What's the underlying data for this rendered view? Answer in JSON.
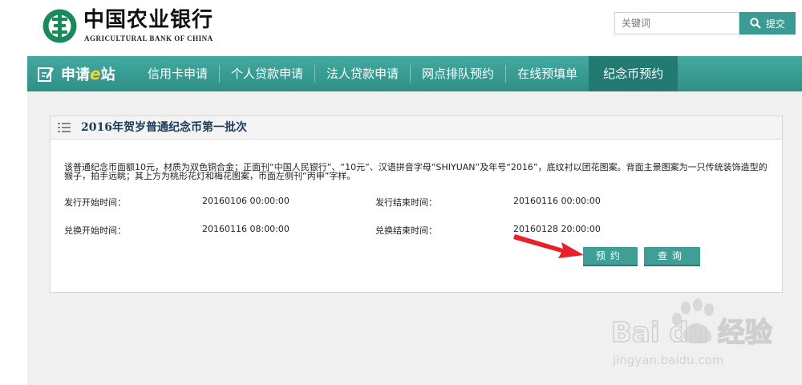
{
  "header": {
    "logo_cn": "中国农业银行",
    "logo_en": "AGRICULTURAL BANK OF CHINA",
    "search_placeholder": "关键词",
    "search_button": "提交"
  },
  "nav": {
    "brand_pre": "申请",
    "brand_e": "e",
    "brand_post": "站",
    "items": [
      "信用卡申请",
      "个人贷款申请",
      "法人贷款申请",
      "网点排队预约",
      "在线预填单",
      "纪念币预约"
    ],
    "active_index": 5
  },
  "panel": {
    "title": "2016年贺岁普通纪念币第一批次",
    "description": "该普通纪念币面额10元，材质为双色铜合金；正面刊“中国人民银行”、“10元”、汉语拼音字母“SHIYUAN”及年号“2016”，底纹衬以团花图案。背面主景图案为一只传统装饰造型的猴子，拍手远眺；其上方为桃形花灯和梅花图案，币面左侧刊“丙申”字样。",
    "issue_start_label": "发行开始时间：",
    "issue_start_value": "20160106 00:00:00",
    "issue_end_label": "发行结束时间：",
    "issue_end_value": "20160116 00:00:00",
    "exchange_start_label": "兑换开始时间：",
    "exchange_start_value": "20160116 08:00:00",
    "exchange_end_label": "兑换结束时间：",
    "exchange_end_value": "20160128 20:00:00",
    "reserve_button": "预约",
    "query_button": "查询"
  },
  "watermark": {
    "brand": "Bai du 经验",
    "url": "jingyan.baidu.com"
  },
  "colors": {
    "nav_green": "#3a9b94",
    "active_tab": "#237a72",
    "button": "#3f9f96",
    "arrow": "#e8202a"
  }
}
